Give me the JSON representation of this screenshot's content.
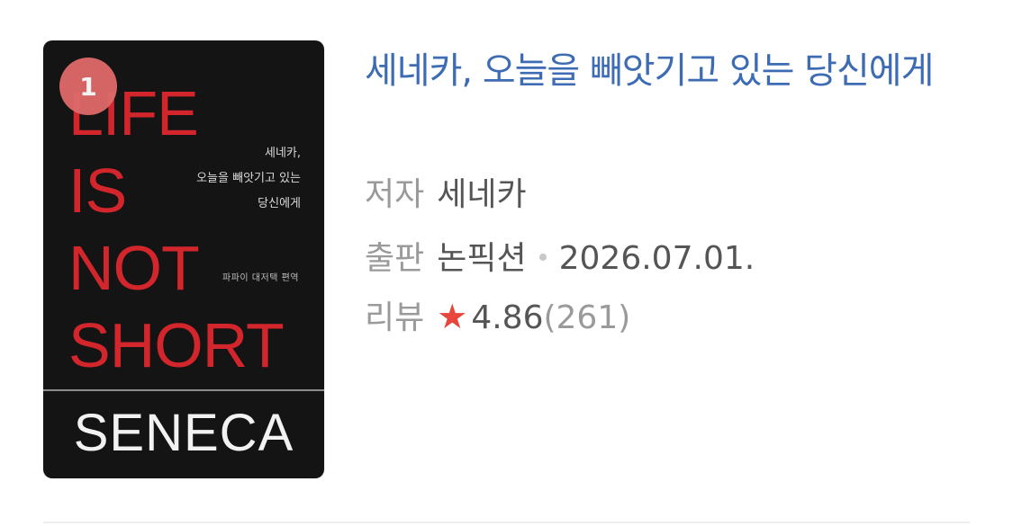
{
  "book": {
    "rank": "1",
    "title": "세네카, 오늘을 빼앗기고 있는 당신에게",
    "author_label": "저자",
    "author": "세네카",
    "publisher_label": "출판",
    "publisher": "논픽션",
    "date": "2026.07.01.",
    "review_label": "리뷰",
    "rating": "4.86",
    "review_count": "(261)",
    "star_icon": "star-icon",
    "accent_color": "#3d6bb4",
    "star_color": "#e8453c"
  },
  "cover": {
    "title": "LIFE\nIS\nNOT\nSHORT",
    "subtitle": "세네카,\n오늘을 빼앗기고 있는\n당신에게",
    "translator": "파파이 대저택 편역",
    "author": "SENECA",
    "title_color": "#d2262c"
  }
}
